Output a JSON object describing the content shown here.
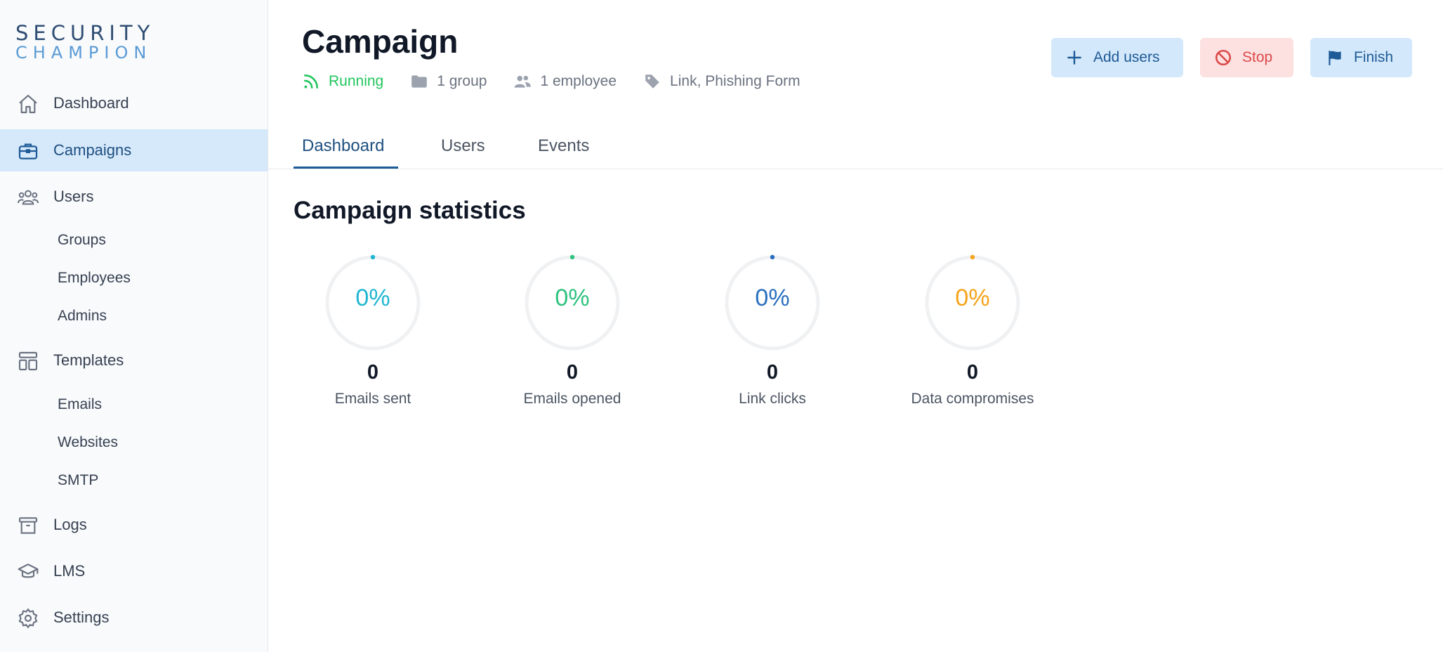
{
  "logo": {
    "line1": "SECURITY",
    "line2": "CHAMPION"
  },
  "sidebar": {
    "items": [
      {
        "label": "Dashboard",
        "icon": "home-icon"
      },
      {
        "label": "Campaigns",
        "icon": "briefcase-icon",
        "active": true
      },
      {
        "label": "Users",
        "icon": "users-icon"
      },
      {
        "label": "Groups"
      },
      {
        "label": "Employees"
      },
      {
        "label": "Admins"
      },
      {
        "label": "Templates",
        "icon": "templates-icon"
      },
      {
        "label": "Emails"
      },
      {
        "label": "Websites"
      },
      {
        "label": "SMTP"
      },
      {
        "label": "Logs",
        "icon": "archive-icon"
      },
      {
        "label": "LMS",
        "icon": "graduation-cap-icon"
      },
      {
        "label": "Settings",
        "icon": "gear-icon"
      }
    ]
  },
  "header": {
    "title": "Campaign",
    "status": "Running",
    "groups": "1 group",
    "employees": "1 employee",
    "tags": "Link, Phishing Form",
    "buttons": {
      "add_users": "Add users",
      "stop": "Stop",
      "finish": "Finish"
    }
  },
  "tabs": [
    {
      "label": "Dashboard",
      "active": true
    },
    {
      "label": "Users"
    },
    {
      "label": "Events"
    }
  ],
  "stats": {
    "title": "Campaign statistics",
    "items": [
      {
        "percent": "0%",
        "count": "0",
        "label": "Emails sent",
        "color": "#1fb5d1",
        "fraction": 0
      },
      {
        "percent": "0%",
        "count": "0",
        "label": "Emails opened",
        "color": "#2ec27e",
        "fraction": 0
      },
      {
        "percent": "0%",
        "count": "0",
        "label": "Link clicks",
        "color": "#2a6fbf",
        "fraction": 0
      },
      {
        "percent": "0%",
        "count": "0",
        "label": "Data compromises",
        "color": "#f5a31a",
        "fraction": 0
      }
    ]
  },
  "colors": {
    "accent": "#1e5a96",
    "active_bg": "#d6e9fb",
    "running": "#22c55e",
    "stop": "#dc4a4a"
  }
}
